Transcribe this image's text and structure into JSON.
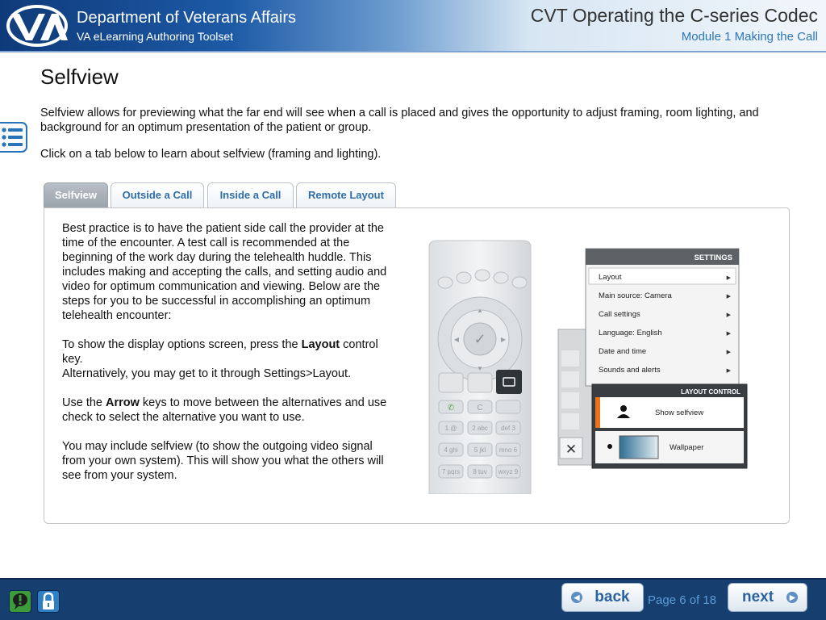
{
  "header": {
    "org_name": "Department of Veterans Affairs",
    "org_sub": "VA eLearning Authoring Toolset",
    "course_title": "CVT Operating the C-series Codec",
    "module_title": "Module 1 Making the Call"
  },
  "page": {
    "heading": "Selfview",
    "intro": "Selfview allows for previewing what the far end will see when a call is placed and gives the opportunity to adjust framing, room lighting, and background for an optimum presentation of the patient or group.",
    "instruction": "Click on a tab below to learn about selfview (framing and lighting)."
  },
  "tabs": [
    {
      "label": "Selfview",
      "active": true
    },
    {
      "label": "Outside a Call",
      "active": false
    },
    {
      "label": "Inside a Call",
      "active": false
    },
    {
      "label": "Remote Layout",
      "active": false
    }
  ],
  "panel": {
    "p1": "Best practice is to have the patient side call the provider at the time of the encounter. A test call is recommended at the beginning of the work day during the telehealth huddle. This includes making and accepting the calls, and setting audio and video for optimum communication and viewing. Below are the steps for you to be successful in accomplishing an optimum telehealth encounter:",
    "p2_a": "To show the display options screen, press the ",
    "p2_bold": "Layout",
    "p2_b": " control key.",
    "p2_c": "Alternatively, you may get to it through Settings>Layout.",
    "p3_a": "Use the ",
    "p3_bold": "Arrow",
    "p3_b": " keys to move between the alternatives and use check to select the alternative you want to use.",
    "p4": "You may include selfview (to show the outgoing video signal from your own system). This will show you what the others will see from your system."
  },
  "illustration": {
    "settings_title": "SETTINGS",
    "settings_items": [
      "Layout",
      "Main source: Camera",
      "Call settings",
      "Language: English",
      "Date and time",
      "Sounds and alerts"
    ],
    "layout_control_title": "LAYOUT CONTROL",
    "layout_options": [
      "Show selfview",
      "Wallpaper"
    ],
    "remote_keys": [
      "C",
      "1.@",
      "2 abc",
      "def 3",
      "4 ghi",
      "5 jkl",
      "mno 6",
      "7 pqrs",
      "8 tuv",
      "wxyz 9"
    ]
  },
  "footer": {
    "back_label": "back",
    "next_label": "next",
    "page_indicator": "Page 6 of 18"
  },
  "colors": {
    "header_dark": "#0e3a7a",
    "link_blue": "#2f6ea9",
    "footer_bg": "#163f6f",
    "accent_orange": "#e8731c"
  }
}
